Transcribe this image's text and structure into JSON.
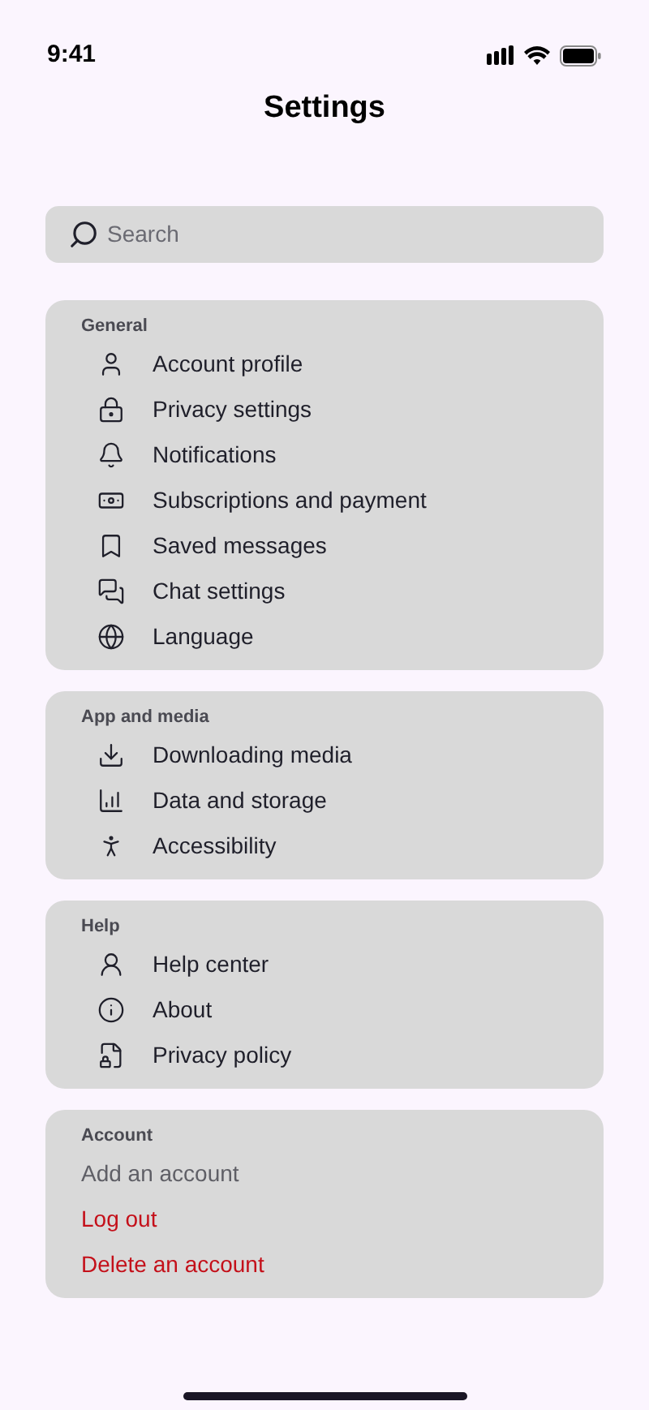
{
  "status_bar": {
    "time": "9:41"
  },
  "title": "Settings",
  "search": {
    "placeholder": "Search"
  },
  "sections": [
    {
      "heading": "General",
      "items": [
        {
          "label": "Account profile",
          "kind": "link"
        },
        {
          "label": "Privacy settings",
          "kind": "link"
        },
        {
          "label": "Notifications",
          "kind": "link"
        },
        {
          "label": "Subscriptions and payment",
          "kind": "link"
        },
        {
          "label": "Saved messages",
          "kind": "link"
        },
        {
          "label": "Chat settings",
          "kind": "link"
        },
        {
          "label": "Language",
          "kind": "link"
        }
      ]
    },
    {
      "heading": "App and media",
      "items": [
        {
          "label": "Downloading media",
          "kind": "link"
        },
        {
          "label": "Data and storage",
          "kind": "link"
        },
        {
          "label": "Accessibility",
          "kind": "link"
        }
      ]
    },
    {
      "heading": "Help",
      "items": [
        {
          "label": "Help center",
          "kind": "link"
        },
        {
          "label": "About",
          "kind": "link"
        },
        {
          "label": "Privacy policy",
          "kind": "link"
        }
      ]
    },
    {
      "heading": "Account",
      "items": [
        {
          "label": "Add an account",
          "kind": "plain"
        },
        {
          "label": "Log out",
          "kind": "danger"
        },
        {
          "label": "Delete an account",
          "kind": "danger"
        }
      ]
    }
  ]
}
